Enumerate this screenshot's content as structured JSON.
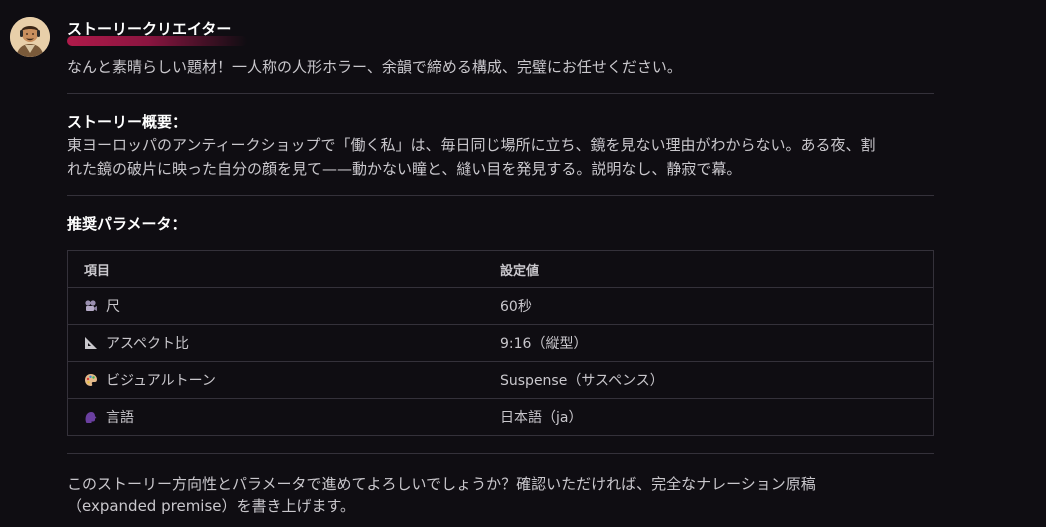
{
  "message": {
    "sender": "ストーリークリエイター",
    "intro": "なんと素晴らしい題材！一人称の人形ホラー、余韻で締める構成、完璧にお任せください。",
    "overview": {
      "title": "ストーリー概要：",
      "line1": "東ヨーロッパのアンティークショップで「働く私」は、毎日同じ場所に立ち、鏡を見ない理由がわからない。ある夜、割",
      "line2": "れた鏡の破片に映った自分の顔を見て——動かない瞳と、縫い目を発見する。説明なし、静寂で幕。"
    },
    "params": {
      "title": "推奨パラメータ：",
      "headers": [
        "項目",
        "設定値"
      ],
      "rows": [
        {
          "icon": "film-projector-icon",
          "item": "尺",
          "value": "60秒"
        },
        {
          "icon": "triangle-ruler-icon",
          "item": "アスペクト比",
          "value": "9:16（縦型）"
        },
        {
          "icon": "artist-palette-icon",
          "item": "ビジュアルトーン",
          "value": "Suspense（サスペンス）"
        },
        {
          "icon": "speaking-head-icon",
          "item": "言語",
          "value": "日本語（ja）"
        }
      ]
    },
    "footer": {
      "line1": "このストーリー方向性とパラメータで進めてよろしいでしょうか？確認いただければ、完全なナレーション原稿",
      "line2": "（expanded premise）を書き上げます。"
    }
  },
  "colors": {
    "background": "#0f0d12",
    "text": "#c9c7cc",
    "heading": "#ffffff",
    "divider": "#34313a",
    "accent": "#b01a4a"
  }
}
